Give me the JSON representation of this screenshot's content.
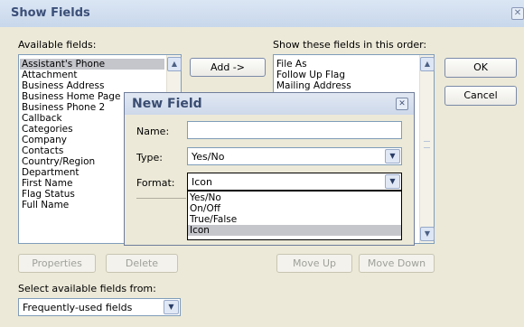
{
  "show_fields": {
    "title": "Show Fields",
    "available_label": "Available fields:",
    "order_label": "Show these fields in this order:",
    "available_fields": [
      "Assistant's Phone",
      "Attachment",
      "Business Address",
      "Business Home Page",
      "Business Phone 2",
      "Callback",
      "Categories",
      "Company",
      "Contacts",
      "Country/Region",
      "Department",
      "First Name",
      "Flag Status",
      "Full Name"
    ],
    "selected_available": "Assistant's Phone",
    "shown_fields": [
      "File As",
      "Follow Up Flag",
      "Mailing Address"
    ],
    "add_button": "Add ->",
    "ok_button": "OK",
    "cancel_button": "Cancel",
    "properties_button": "Properties",
    "delete_button": "Delete",
    "move_up_button": "Move Up",
    "move_down_button": "Move Down",
    "select_from_label": "Select available fields from:",
    "select_from_value": "Frequently-used fields"
  },
  "new_field": {
    "title": "New Field",
    "name_label": "Name:",
    "name_value": "",
    "type_label": "Type:",
    "type_value": "Yes/No",
    "format_label": "Format:",
    "format_value": "Icon",
    "format_options": [
      "Yes/No",
      "On/Off",
      "True/False",
      "Icon"
    ],
    "selected_option": "Icon"
  },
  "icons": {
    "close": "close-icon",
    "dropdown": "chevron-down-icon",
    "scroll_up": "chevron-up-icon",
    "scroll_down": "chevron-down-icon"
  }
}
